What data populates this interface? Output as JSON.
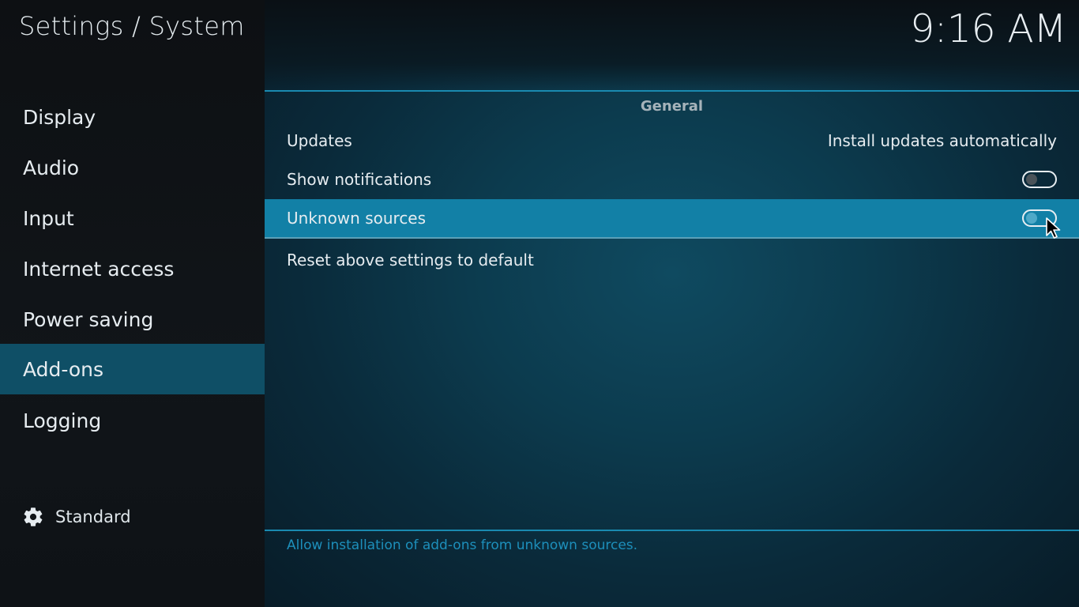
{
  "header": {
    "title": "Settings / System",
    "clock": "9:16 AM"
  },
  "sidebar": {
    "items": [
      {
        "label": "Display",
        "selected": false
      },
      {
        "label": "Audio",
        "selected": false
      },
      {
        "label": "Input",
        "selected": false
      },
      {
        "label": "Internet access",
        "selected": false
      },
      {
        "label": "Power saving",
        "selected": false
      },
      {
        "label": "Add-ons",
        "selected": true
      },
      {
        "label": "Logging",
        "selected": false
      }
    ],
    "settings_level": {
      "icon": "gear-icon",
      "label": "Standard"
    }
  },
  "main": {
    "section": "General",
    "settings": [
      {
        "label": "Updates",
        "type": "value",
        "value": "Install updates automatically"
      },
      {
        "label": "Show notifications",
        "type": "toggle",
        "enabled": false
      },
      {
        "label": "Unknown sources",
        "type": "toggle",
        "enabled": false,
        "focused": true
      },
      {
        "label": "Reset above settings to default",
        "type": "action"
      }
    ],
    "help_text": "Allow installation of add-ons from unknown sources."
  },
  "colors": {
    "accent": "#1280a6",
    "sidebar_selected": "#0f4f66",
    "divider": "#1a8ab0",
    "help_text": "#1d8fbb"
  }
}
